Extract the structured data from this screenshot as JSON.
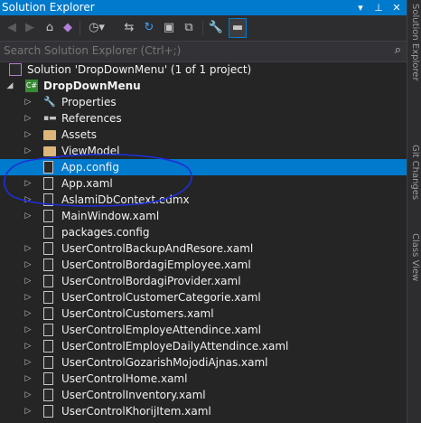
{
  "window": {
    "title": "Solution Explorer"
  },
  "toolbar": {
    "buttons": [
      "back-icon",
      "forward-icon",
      "home-icon",
      "vs-icon",
      "history-icon",
      "sync-icon",
      "refresh-icon",
      "collapse-icon",
      "copy-icon",
      "properties-wrench-icon",
      "preview-icon"
    ]
  },
  "search": {
    "placeholder": "Search Solution Explorer (Ctrl+;)"
  },
  "side_tabs": [
    "Solution Explorer",
    "Git Changes",
    "Class View"
  ],
  "tree": {
    "solution_label": "Solution 'DropDownMenu' (1 of 1 project)",
    "project_label": "DropDownMenu",
    "items": [
      {
        "label": "Properties",
        "icon": "wrench-icon"
      },
      {
        "label": "References",
        "icon": "references-icon"
      },
      {
        "label": "Assets",
        "icon": "folder-icon"
      },
      {
        "label": "ViewModel",
        "icon": "folder-icon"
      },
      {
        "label": "App.config",
        "icon": "config-file-icon",
        "selected": true
      },
      {
        "label": "App.xaml",
        "icon": "xaml-file-icon"
      },
      {
        "label": "AslamiDbContext.edmx",
        "icon": "edmx-file-icon"
      },
      {
        "label": "MainWindow.xaml",
        "icon": "xaml-file-icon"
      },
      {
        "label": "packages.config",
        "icon": "config-file-icon"
      },
      {
        "label": "UserControlBackupAndResore.xaml",
        "icon": "xaml-file-icon"
      },
      {
        "label": "UserControlBordagiEmployee.xaml",
        "icon": "xaml-file-icon"
      },
      {
        "label": "UserControlBordagiProvider.xaml",
        "icon": "xaml-file-icon"
      },
      {
        "label": "UserControlCustomerCategorie.xaml",
        "icon": "xaml-file-icon"
      },
      {
        "label": "UserControlCustomers.xaml",
        "icon": "xaml-file-icon"
      },
      {
        "label": "UserControlEmployeAttendince.xaml",
        "icon": "xaml-file-icon"
      },
      {
        "label": "UserControlEmployeDailyAttendince.xaml",
        "icon": "xaml-file-icon"
      },
      {
        "label": "UserControlGozarishMojodiAjnas.xaml",
        "icon": "xaml-file-icon"
      },
      {
        "label": "UserControlHome.xaml",
        "icon": "xaml-file-icon"
      },
      {
        "label": "UserControlInventory.xaml",
        "icon": "xaml-file-icon"
      },
      {
        "label": "UserControlKhorijItem.xaml",
        "icon": "xaml-file-icon"
      }
    ]
  },
  "colors": {
    "accent": "#007acc",
    "background": "#252526",
    "annotation": "#1e2fd6"
  }
}
